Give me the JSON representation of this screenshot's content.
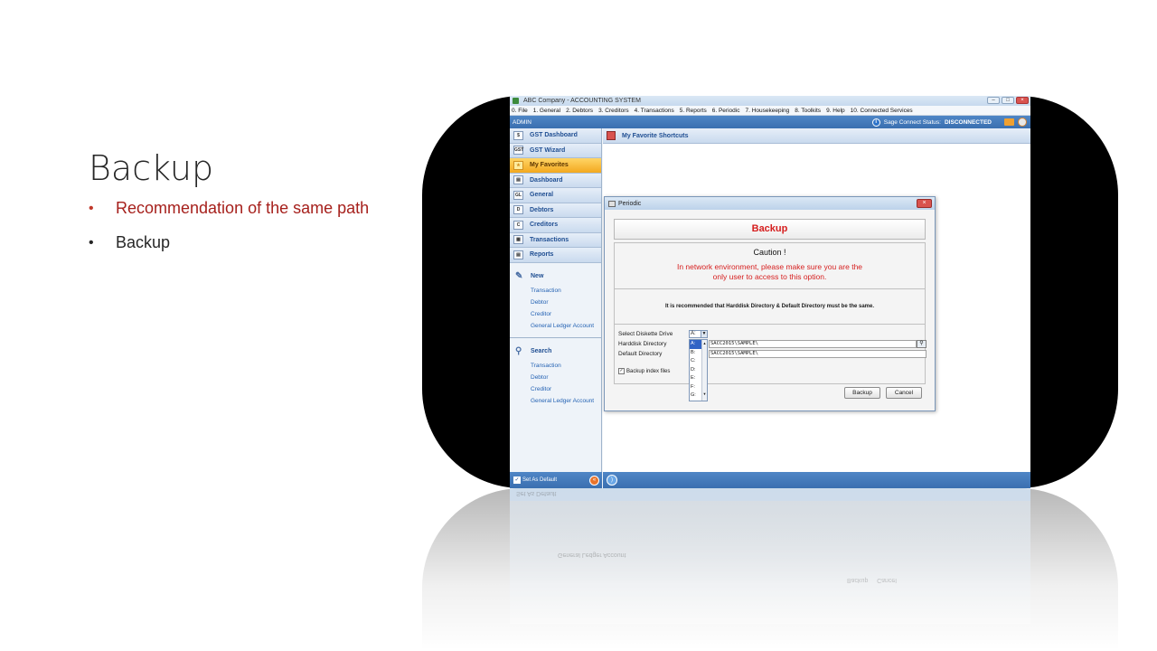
{
  "slide": {
    "title": "Backup",
    "bullets": [
      "Recommendation of the same path",
      "Backup"
    ]
  },
  "app": {
    "window_title": "ABC Company - ACCOUNTING SYSTEM",
    "menu": [
      "0. File",
      "1. General",
      "2. Debtors",
      "3. Creditors",
      "4. Transactions",
      "5. Reports",
      "6. Periodic",
      "7. Housekeeping",
      "8. Toolkits",
      "9. Help",
      "10. Connected Services"
    ],
    "status": {
      "user": "ADMIN",
      "label": "Sage Connect Status:",
      "value": "DISCONNECTED"
    },
    "sidebar": {
      "nav": [
        {
          "label": "GST Dashboard",
          "icon": "gst-dashboard-icon",
          "glyph": "$"
        },
        {
          "label": "GST Wizard",
          "icon": "gst-wizard-icon",
          "glyph": "GST"
        },
        {
          "label": "My Favorites",
          "icon": "star-icon",
          "glyph": "★"
        },
        {
          "label": "Dashboard",
          "icon": "dashboard-icon",
          "glyph": "▤"
        },
        {
          "label": "General",
          "icon": "general-ledger-icon",
          "glyph": "GL"
        },
        {
          "label": "Debtors",
          "icon": "debtors-icon",
          "glyph": "D"
        },
        {
          "label": "Creditors",
          "icon": "creditors-icon",
          "glyph": "C"
        },
        {
          "label": "Transactions",
          "icon": "transactions-icon",
          "glyph": "▦"
        },
        {
          "label": "Reports",
          "icon": "reports-icon",
          "glyph": "▤"
        }
      ],
      "new_section": {
        "title": "New",
        "links": [
          "Transaction",
          "Debtor",
          "Creditor",
          "General Ledger Account"
        ]
      },
      "search_section": {
        "title": "Search",
        "links": [
          "Transaction",
          "Debtor",
          "Creditor",
          "General Ledger Account"
        ]
      },
      "set_default": "Set As Default"
    },
    "main_header": "My Favorite Shortcuts",
    "dialog": {
      "window_title": "Periodic",
      "heading": "Backup",
      "caution_title": "Caution !",
      "caution_line1": "In network environment, please make sure you are the",
      "caution_line2": "only user to access to this option.",
      "recommendation": "It is recommended that Harddisk Directory & Default Directory must be the same.",
      "labels": {
        "drive": "Select Diskette Drive",
        "harddisk": "Harddisk Directory",
        "default": "Default Directory"
      },
      "drive_value": "A:",
      "drive_options": [
        "A:",
        "B:",
        "C:",
        "D:",
        "E:",
        "F:",
        "G:"
      ],
      "harddisk_value": "SACC2015\\SAMPLE\\",
      "default_value": "SACC2015\\SAMPLE\\",
      "backup_index_label": "Backup index files",
      "backup_button": "Backup",
      "cancel_button": "Cancel"
    }
  },
  "reflection": {
    "set_default": "Set As Default",
    "link": "General Ledger Account",
    "backup_button": "Backup",
    "cancel_button": "Cancel"
  }
}
